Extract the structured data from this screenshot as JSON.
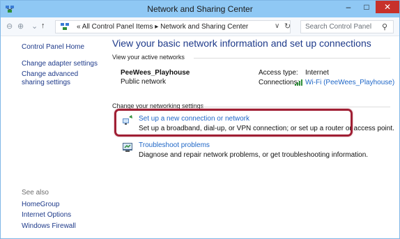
{
  "window": {
    "title": "Network and Sharing Center"
  },
  "controls": {
    "minimize": "–",
    "maximize": "□",
    "close": "✕"
  },
  "address": {
    "path": "« All Control Panel Items ▸ Network and Sharing Center",
    "dropdown": "∨",
    "refresh": "↻"
  },
  "search": {
    "placeholder": "Search Control Panel"
  },
  "sidebar": {
    "links": [
      "Control Panel Home",
      "Change adapter settings",
      "Change advanced sharing settings"
    ],
    "see_also_label": "See also",
    "see_also": [
      "HomeGroup",
      "Internet Options",
      "Windows Firewall"
    ]
  },
  "main": {
    "heading": "View your basic network information and set up connections",
    "active_networks_label": "View your active networks",
    "network": {
      "name": "PeeWees_Playhouse",
      "type": "Public network",
      "access_label": "Access type:",
      "access_value": "Internet",
      "connections_label": "Connections:",
      "connections_value": "Wi-Fi (PeeWees_Playhouse)"
    },
    "settings_label": "Change your networking settings",
    "tasks": [
      {
        "title": "Set up a new connection or network",
        "desc": "Set up a broadband, dial-up, or VPN connection; or set up a router or access point."
      },
      {
        "title": "Troubleshoot problems",
        "desc": "Diagnose and repair network problems, or get troubleshooting information."
      }
    ]
  },
  "colors": {
    "titlebar": "#8fc8f4",
    "link": "#1e66c7",
    "highlight": "#a01f34",
    "close": "#c7312b"
  }
}
